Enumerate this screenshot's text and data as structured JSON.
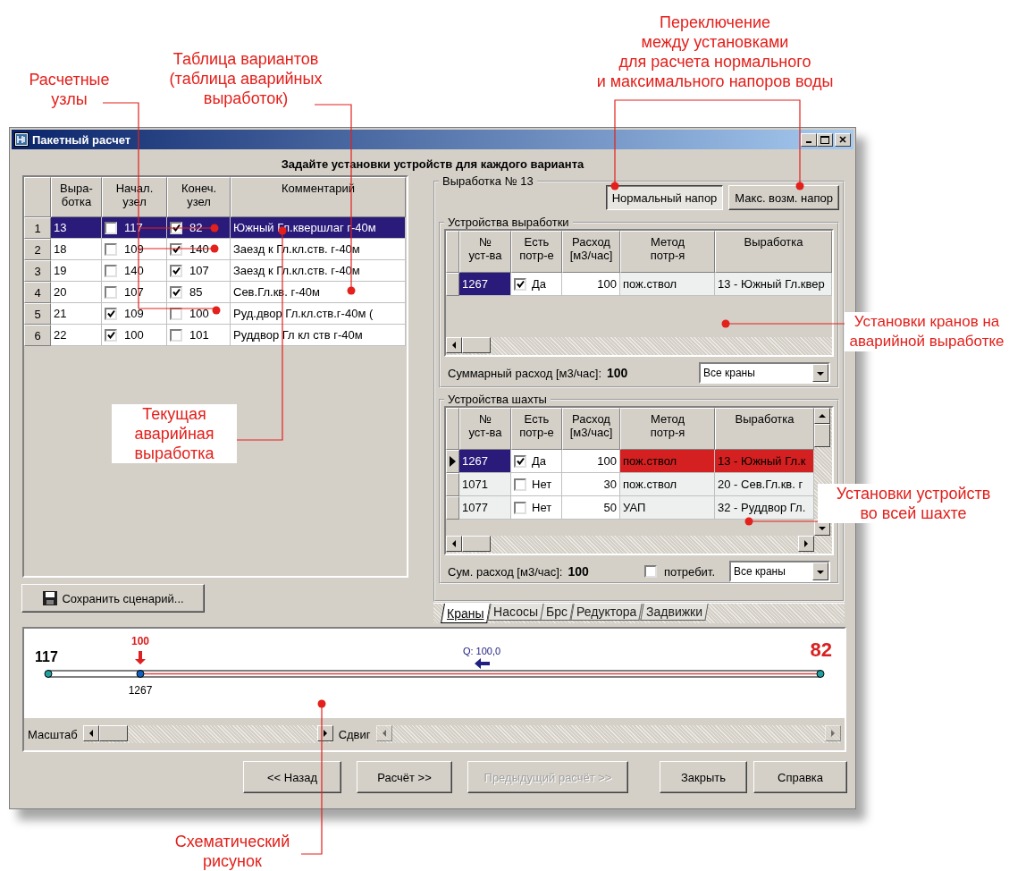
{
  "annotations": [
    {
      "text": "Расчетные\nузлы"
    },
    {
      "text": "Таблица вариантов\n(таблица аварийных\nвыработок)"
    },
    {
      "text": "Переключение\nмежду установками\nдля расчета нормального\nи максимального напоров воды"
    },
    {
      "text": "Текущая\nаварийная\nвыработка"
    },
    {
      "text": "Установки кранов на\nаварийной выработке"
    },
    {
      "text": "Установки устройств\nво всей шахте"
    },
    {
      "text": "Схематический\nрисунок"
    }
  ],
  "window": {
    "title": "Пакетный расчет",
    "heading": "Задайте установки устройств для каждого варианта"
  },
  "variants_table": {
    "columns": [
      "Выра-\nботка",
      "Начал.\nузел",
      "Конеч.\nузел",
      "Комментарий"
    ],
    "rows": [
      {
        "number": "1",
        "selected": true,
        "working": "13",
        "start_checked": false,
        "start": "117",
        "end_checked": true,
        "end": "82",
        "comment": "Южный Гл.квершлаг г-40м"
      },
      {
        "number": "2",
        "selected": false,
        "working": "18",
        "start_checked": false,
        "start": "109",
        "end_checked": true,
        "end": "140",
        "comment": "Заезд к Гл.кл.ств. г-40м"
      },
      {
        "number": "3",
        "selected": false,
        "working": "19",
        "start_checked": false,
        "start": "140",
        "end_checked": true,
        "end": "107",
        "comment": "Заезд к Гл.кл.ств. г-40м"
      },
      {
        "number": "4",
        "selected": false,
        "working": "20",
        "start_checked": false,
        "start": "107",
        "end_checked": true,
        "end": "85",
        "comment": "Сев.Гл.кв. г-40м"
      },
      {
        "number": "5",
        "selected": false,
        "working": "21",
        "start_checked": true,
        "start": "109",
        "end_checked": false,
        "end": "100",
        "comment": "Руд.двор Гл.кл.ств.г-40м ("
      },
      {
        "number": "6",
        "selected": false,
        "working": "22",
        "start_checked": true,
        "start": "100",
        "end_checked": false,
        "end": "101",
        "comment": "Руддвор Гл кл ств г-40м"
      }
    ]
  },
  "save_button": "Сохранить сценарий...",
  "working_panel": {
    "title": "Выработка № 13",
    "pressure_buttons": [
      {
        "label": "Нормальный напор",
        "selected": true
      },
      {
        "label": "Макс. возм. напор",
        "selected": false
      }
    ],
    "working_devices": {
      "title": "Устройства выработки",
      "columns": [
        "№\nуст-ва",
        "Есть\nпотр-е",
        "Расход\n[м3/час]",
        "Метод\nпотр-я",
        "Выработка"
      ],
      "rows": [
        {
          "number": "1267",
          "selected": true,
          "highlighted": false,
          "consumes": true,
          "consumes_label": "Да",
          "flow": "100",
          "method": "пож.ствол",
          "working": "13 - Южный Гл.квер"
        }
      ],
      "total_label": "Суммарный расход [м3/час]:",
      "total": "100",
      "filter": "Все краны"
    },
    "mine_devices": {
      "title": "Устройства шахты",
      "columns": [
        "№\nуст-ва",
        "Есть\nпотр-е",
        "Расход\n[м3/час]",
        "Метод\nпотр-я",
        "Выработка"
      ],
      "rows": [
        {
          "number": "1267",
          "selected": true,
          "highlighted": true,
          "consumes": true,
          "consumes_label": "Да",
          "flow": "100",
          "method": "пож.ствол",
          "working": "13 - Южный Гл.к"
        },
        {
          "number": "1071",
          "selected": false,
          "highlighted": false,
          "consumes": false,
          "consumes_label": "Нет",
          "flow": "30",
          "method": "пож.ствол",
          "working": "20 - Сев.Гл.кв. г"
        },
        {
          "number": "1077",
          "selected": false,
          "highlighted": false,
          "consumes": false,
          "consumes_label": "Нет",
          "flow": "50",
          "method": "УАП",
          "working": "32 - Руддвор Гл."
        }
      ],
      "total_label": "Сум. расход [м3/час]:",
      "total": "100",
      "consumer_checkbox": {
        "label": "потребит.",
        "checked": false
      },
      "filter": "Все краны"
    },
    "tabs": [
      {
        "label": "Краны",
        "selected": true
      },
      {
        "label": "Насосы",
        "selected": false
      },
      {
        "label": "Брс",
        "selected": false
      },
      {
        "label": "Редуктора",
        "selected": false
      },
      {
        "label": "Задвижки",
        "selected": false
      }
    ]
  },
  "schematic": {
    "start_node": "117",
    "end_node": "82",
    "load": "100",
    "device": "1267",
    "flow_label": "Q: 100,0",
    "scale_label": "Масштаб",
    "shift_label": "Сдвиг"
  },
  "nav_buttons": [
    {
      "label": "<< Назад",
      "disabled": false
    },
    {
      "label": "Расчёт >>",
      "disabled": false
    },
    {
      "label": "Предыдущий расчёт >>",
      "disabled": true
    }
  ],
  "dialog_buttons": [
    {
      "label": "Закрыть",
      "disabled": false
    },
    {
      "label": "Справка",
      "disabled": false
    }
  ]
}
